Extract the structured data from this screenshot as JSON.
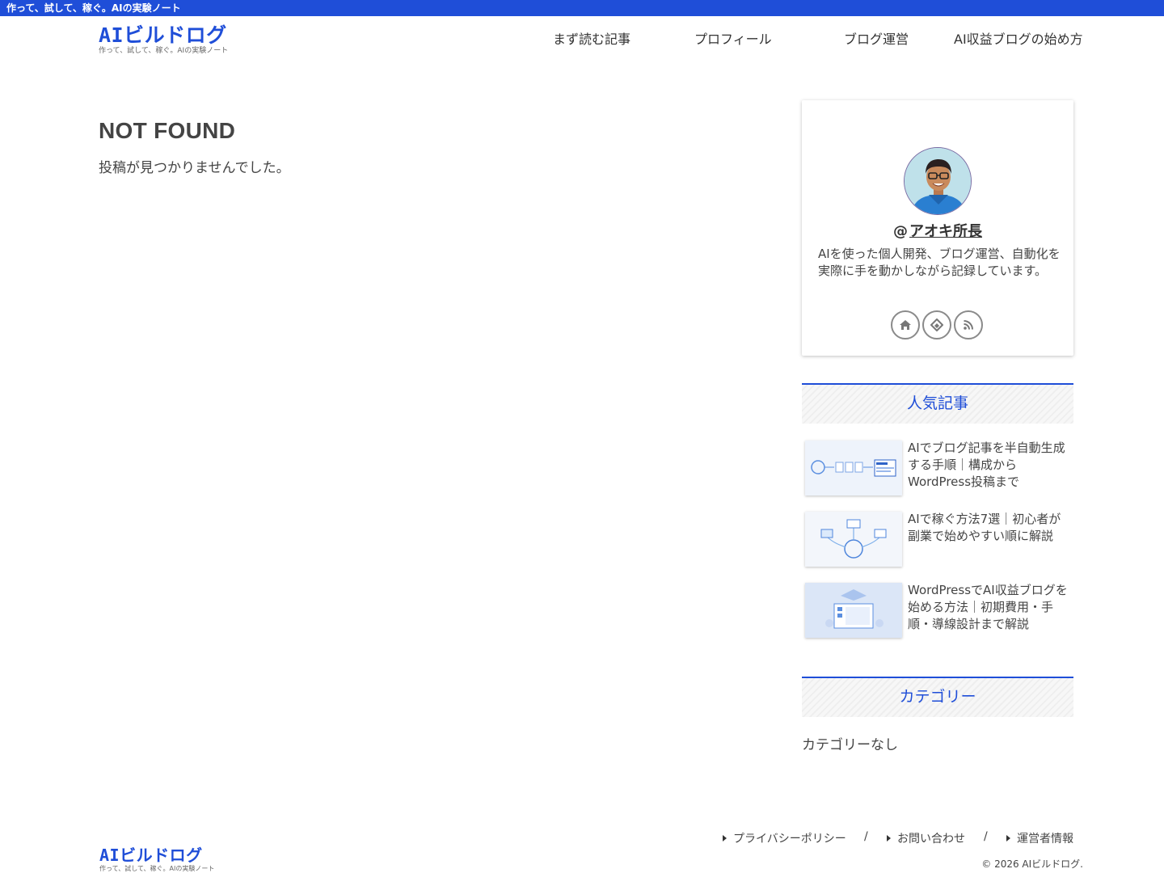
{
  "topbar": {
    "text": "作って、試して、稼ぐ。AIの実験ノート"
  },
  "site": {
    "title": "AIビルドログ",
    "tagline": "作って、試して、稼ぐ。AIの実験ノート"
  },
  "nav": {
    "items": [
      {
        "label": "まず読む記事"
      },
      {
        "label": "プロフィール"
      },
      {
        "label": "ブログ運営"
      },
      {
        "label": "AI収益ブログの始め方"
      }
    ]
  },
  "main": {
    "title": "NOT FOUND",
    "message": "投稿が見つかりませんでした。"
  },
  "profile": {
    "at": "@",
    "name": "アオキ所長",
    "description": "AIを使った個人開発、ブログ運営、自動化を実際に手を動かしながら記録しています。",
    "social": [
      {
        "icon": "home-icon"
      },
      {
        "icon": "feedly-icon"
      },
      {
        "icon": "rss-icon"
      }
    ]
  },
  "popular": {
    "heading": "人気記事",
    "posts": [
      {
        "title": "AIでブログ記事を半自動生成する手順｜構成からWordPress投稿まで"
      },
      {
        "title": "AIで稼ぐ方法7選｜初心者が副業で始めやすい順に解説"
      },
      {
        "title": "WordPressでAI収益ブログを始める方法｜初期費用・手順・導線設計まで解説"
      }
    ]
  },
  "category": {
    "heading": "カテゴリー",
    "empty": "カテゴリーなし"
  },
  "footer": {
    "links": [
      {
        "label": "プライバシーポリシー"
      },
      {
        "label": "お問い合わせ"
      },
      {
        "label": "運営者情報"
      }
    ],
    "separator": "/",
    "copyright": "© 2026 AIビルドログ."
  },
  "colors": {
    "accent": "#1f4ed8",
    "text": "#333333"
  }
}
